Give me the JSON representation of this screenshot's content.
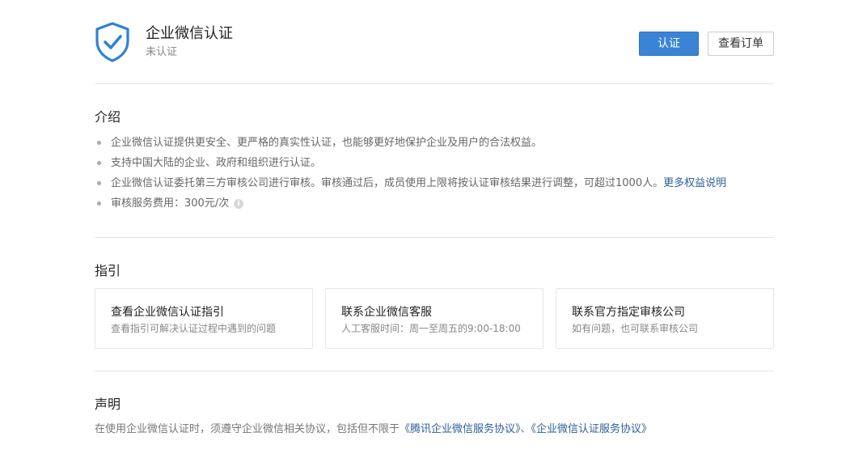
{
  "header": {
    "title": "企业微信认证",
    "status": "未认证",
    "verify_button": "认证",
    "orders_button": "查看订单",
    "accent_color": "#3b84d5"
  },
  "intro": {
    "title": "介绍",
    "items": [
      "企业微信认证提供更安全、更严格的真实性认证，也能够更好地保护企业及用户的合法权益。",
      "支持中国大陆的企业、政府和组织进行认证。",
      "企业微信认证委托第三方审核公司进行审核。审核通过后，成员使用上限将按认证审核结果进行调整，可超过1000人。",
      "审核服务费用：300元/次"
    ],
    "more_link": "更多权益说明"
  },
  "guide": {
    "title": "指引",
    "cards": [
      {
        "title": "查看企业微信认证指引",
        "desc": "查看指引可解决认证过程中遇到的问题"
      },
      {
        "title": "联系企业微信客服",
        "desc": "人工客服时间：周一至周五的9:00-18:00"
      },
      {
        "title": "联系官方指定审核公司",
        "desc": "如有问题，也可联系审核公司"
      }
    ]
  },
  "statement": {
    "title": "声明",
    "text": "在使用企业微信认证时，须遵守企业微信相关协议，包括但不限于",
    "link1": "《腾讯企业微信服务协议》",
    "separator": "、",
    "link2": "《企业微信认证服务协议》"
  }
}
